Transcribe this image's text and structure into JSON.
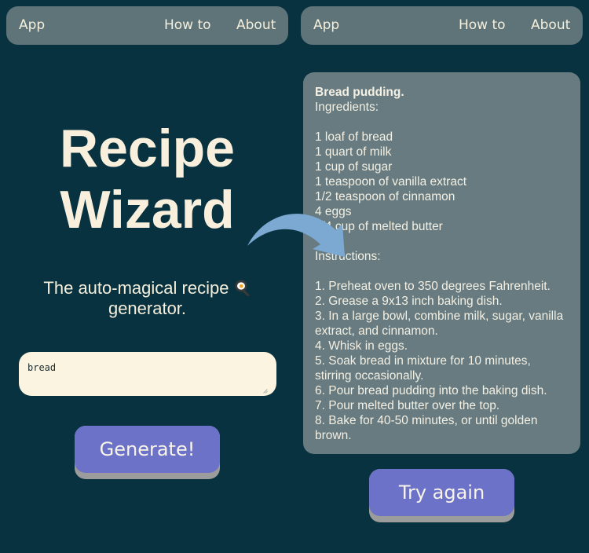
{
  "left_screen": {
    "nav": {
      "app": "App",
      "how_to": "How to",
      "about": "About"
    },
    "title_line1": "Recipe",
    "title_line2": "Wizard",
    "subtitle_part1": "The auto-magical recipe",
    "subtitle_part2": "generator.",
    "subtitle_icon": "frying-pan-egg-icon",
    "input_value": "bread",
    "generate_label": "Generate!"
  },
  "right_screen": {
    "nav": {
      "app": "App",
      "how_to": "How to",
      "about": "About"
    },
    "recipe": {
      "title": "Bread pudding.",
      "ingredients_heading": "Ingredients:",
      "ingredients": [
        "1 loaf of bread",
        "1 quart of milk",
        "1 cup of sugar",
        "1 teaspoon of vanilla extract",
        "1/2 teaspoon of cinnamon",
        "4 eggs",
        "1/4 cup of melted butter"
      ],
      "instructions_heading": "Instructions:",
      "instructions": [
        "1. Preheat oven to 350 degrees Fahrenheit.",
        "2. Grease a 9x13 inch baking dish.",
        "3. In a large bowl, combine milk, sugar, vanilla extract, and cinnamon.",
        "4. Whisk in eggs.",
        "5. Soak bread in mixture for 10 minutes, stirring occasionally.",
        "6. Pour bread pudding into the baking dish.",
        "7. Pour melted butter over the top.",
        "8. Bake for 40-50 minutes, or until golden brown."
      ]
    },
    "try_again_label": "Try again"
  },
  "colors": {
    "background": "#08323f",
    "navbar": "#5e7479",
    "card": "#677b80",
    "button": "#6b72c8",
    "button_shadow": "#9c9c9c",
    "cream": "#f8f0dc",
    "arrow": "#7ba9d2"
  }
}
